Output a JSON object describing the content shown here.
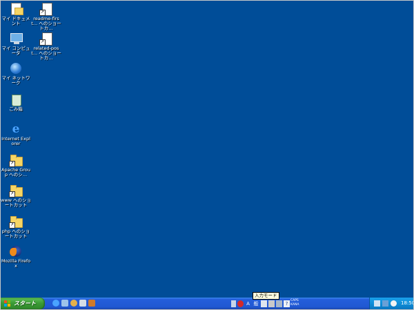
{
  "desktop": {
    "icons": [
      {
        "label": "マイ ドキュメント",
        "icon": "my-documents-icon"
      },
      {
        "label": "マイ コンピュータ",
        "icon": "my-computer-icon"
      },
      {
        "label": "マイ ネットワーク",
        "icon": "my-network-icon"
      },
      {
        "label": "ごみ箱",
        "icon": "recycle-bin-icon"
      },
      {
        "label": "Internet Explorer",
        "icon": "internet-explorer-icon"
      },
      {
        "label": "Apache Group へのシ…",
        "icon": "folder-shortcut-icon"
      },
      {
        "label": "www へのショートカット",
        "icon": "folder-shortcut-icon"
      },
      {
        "label": "php へのショートカット",
        "icon": "folder-shortcut-icon"
      },
      {
        "label": "Mozilla Firefox",
        "icon": "firefox-icon"
      },
      {
        "label": "readme-first… へのショートカ…",
        "icon": "document-shortcut-icon"
      },
      {
        "label": "related-post… へのショートカ…",
        "icon": "document-shortcut-icon"
      }
    ]
  },
  "tooltip": {
    "text": "入力モード"
  },
  "taskbar": {
    "start_label": "スタート",
    "quick_launch": [
      "ie-quicklaunch-icon",
      "show-desktop-icon",
      "media-icon",
      "app-icon",
      "app2-icon"
    ],
    "language_bar": {
      "mode": "A",
      "kana": "般"
    },
    "caps_text": "CAPS",
    "kana_text": "KANA",
    "clock": "18:50"
  },
  "colors": {
    "desktop": "#004d98",
    "taskbar": "#245edb",
    "start": "#3a9a34",
    "tray": "#0f8ed8"
  }
}
